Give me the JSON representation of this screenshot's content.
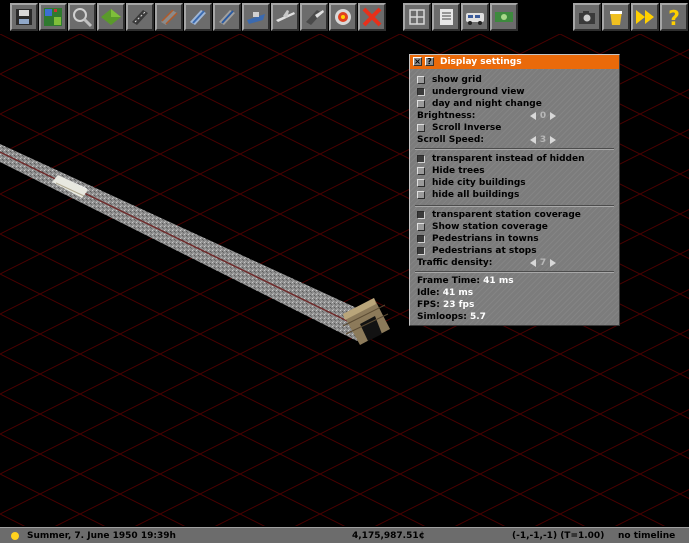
{
  "toolbar": {
    "buttons": [
      {
        "name": "save-game-button"
      },
      {
        "name": "minimap-button"
      },
      {
        "name": "inspect-button"
      },
      {
        "name": "terrain-tools-button"
      },
      {
        "name": "road-tools-button"
      },
      {
        "name": "rail-tools-button"
      },
      {
        "name": "monorail-tools-button"
      },
      {
        "name": "tram-tools-button"
      },
      {
        "name": "ship-tools-button"
      },
      {
        "name": "air-tools-button"
      },
      {
        "name": "stop-tools-button"
      },
      {
        "name": "remove-button"
      },
      {
        "name": "special-buildings-button"
      },
      {
        "name": "list-button"
      },
      {
        "name": "depot-vehicles-button"
      },
      {
        "name": "finances-button"
      },
      {
        "name": "screenshot-button"
      },
      {
        "name": "pause-button"
      },
      {
        "name": "fast-forward-button"
      },
      {
        "name": "help-button"
      }
    ]
  },
  "settings": {
    "title": "Display settings",
    "close_glyph": "×",
    "help_glyph": "?",
    "items": [
      {
        "label": "show grid",
        "checked": false
      },
      {
        "label": "underground view",
        "checked": true
      },
      {
        "label": "day and night change",
        "checked": false
      }
    ],
    "brightness": {
      "label": "Brightness:",
      "value": "0"
    },
    "scroll_inverse": {
      "label": "Scroll Inverse",
      "checked": false
    },
    "scroll_speed": {
      "label": "Scroll Speed:",
      "value": "3"
    },
    "items2": [
      {
        "label": "transparent instead of hidden",
        "checked": true
      },
      {
        "label": "Hide trees",
        "checked": false
      },
      {
        "label": "hide city buildings",
        "checked": false
      },
      {
        "label": "hide all buildings",
        "checked": false
      }
    ],
    "items3": [
      {
        "label": "transparent station coverage",
        "checked": true
      },
      {
        "label": "Show station coverage",
        "checked": false
      },
      {
        "label": "Pedestrians in towns",
        "checked": true
      },
      {
        "label": "Pedestrians at stops",
        "checked": true
      }
    ],
    "traffic_density": {
      "label": "Traffic density:",
      "value": "7"
    },
    "stats": {
      "frame_time_label": "Frame Time:",
      "frame_time": "41 ms",
      "idle_label": "Idle:",
      "idle": "41 ms",
      "fps_label": "FPS:",
      "fps": "23 fps",
      "simloops_label": "Simloops:",
      "simloops": "5.7"
    }
  },
  "status": {
    "date": "Summer, 7. June 1950 19:39h",
    "money": "4,175,987.51¢",
    "coords": "(-1,-1,-1) (T=1.00)",
    "timeline": "no timeline"
  },
  "colors": {
    "title_bar": "#ea6a0a",
    "grid_lines": "#4a0000",
    "rail_track": "#6e2a2a",
    "sun_icon": "#ffd21e"
  }
}
